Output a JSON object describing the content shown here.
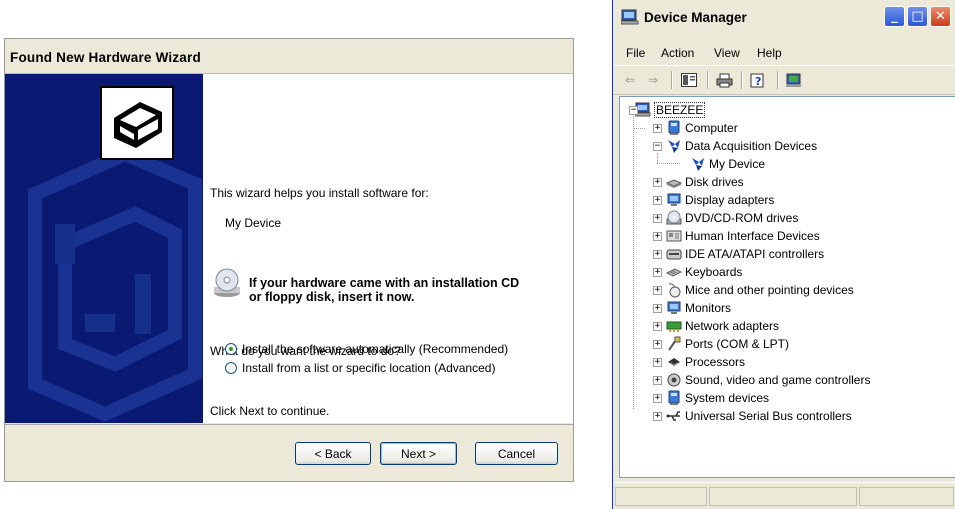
{
  "wizard": {
    "title": "Found New Hardware Wizard",
    "intro": "This wizard helps you install software for:",
    "device_name": "My Device",
    "cd_prompt_line1": "If your hardware came with an installation CD",
    "cd_prompt_line2": "or floppy disk, insert it now.",
    "question": "What do you want the wizard to do?",
    "options": [
      {
        "label": "Install the software automatically (Recommended)",
        "selected": true
      },
      {
        "label": "Install from a list or specific location (Advanced)",
        "selected": false
      }
    ],
    "footer": "Click Next to continue.",
    "buttons": {
      "back": "< Back",
      "next": "Next >",
      "cancel": "Cancel"
    }
  },
  "device_manager": {
    "title": "Device Manager",
    "menu": [
      "File",
      "Action",
      "View",
      "Help"
    ],
    "root": "BEEZEE",
    "items": [
      {
        "label": "Computer",
        "icon": "computer-icon",
        "state": "collapsed"
      },
      {
        "label": "Data Acquisition Devices",
        "icon": "daq-icon",
        "state": "expanded"
      },
      {
        "label": "My Device",
        "icon": "daq-icon",
        "state": "leaf"
      },
      {
        "label": "Disk drives",
        "icon": "disk-icon",
        "state": "collapsed"
      },
      {
        "label": "Display adapters",
        "icon": "display-icon",
        "state": "collapsed"
      },
      {
        "label": "DVD/CD-ROM drives",
        "icon": "cd-icon",
        "state": "collapsed"
      },
      {
        "label": "Human Interface Devices",
        "icon": "hid-icon",
        "state": "collapsed"
      },
      {
        "label": "IDE ATA/ATAPI controllers",
        "icon": "ide-icon",
        "state": "collapsed"
      },
      {
        "label": "Keyboards",
        "icon": "keyboard-icon",
        "state": "collapsed"
      },
      {
        "label": "Mice and other pointing devices",
        "icon": "mouse-icon",
        "state": "collapsed"
      },
      {
        "label": "Monitors",
        "icon": "monitor-icon",
        "state": "collapsed"
      },
      {
        "label": "Network adapters",
        "icon": "network-icon",
        "state": "collapsed"
      },
      {
        "label": "Ports (COM & LPT)",
        "icon": "port-icon",
        "state": "collapsed"
      },
      {
        "label": "Processors",
        "icon": "processor-icon",
        "state": "collapsed"
      },
      {
        "label": "Sound, video and game controllers",
        "icon": "sound-icon",
        "state": "collapsed"
      },
      {
        "label": "System devices",
        "icon": "system-icon",
        "state": "collapsed"
      },
      {
        "label": "Universal Serial Bus controllers",
        "icon": "usb-icon",
        "state": "collapsed"
      }
    ]
  },
  "colors": {
    "wizard_panel": "#0a1a72",
    "xp_face": "#ECE9D8",
    "close_red": "#c93d1b",
    "xp_blue": "#2a5ad7"
  }
}
